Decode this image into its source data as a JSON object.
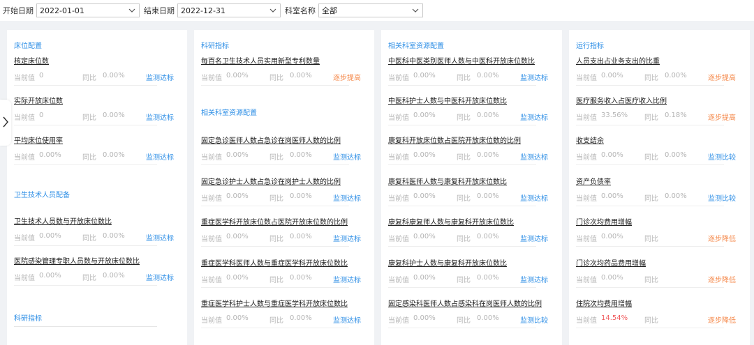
{
  "filters": {
    "start_label": "开始日期",
    "start_value": "2022-01-01",
    "end_label": "结束日期",
    "end_value": "2022-12-31",
    "dept_label": "科室名称",
    "dept_value": "全部"
  },
  "labels": {
    "current": "当前值",
    "yoy": "同比"
  },
  "status_colors": {
    "blue": "#2f8fe6",
    "orange": "#f5894b"
  },
  "columns": [
    {
      "sections": [
        {
          "title": "床位配置",
          "items": [
            {
              "title": "核定床位数",
              "current": "0",
              "yoy": "0.00%",
              "status": "监测达标",
              "color": "blue"
            },
            {
              "title": "实际开放床位数",
              "current": "0",
              "yoy": "0.00%",
              "status": "监测达标",
              "color": "blue"
            },
            {
              "title": "平均床位使用率",
              "current": "0.00%",
              "yoy": "0.00%",
              "status": "监测达标",
              "color": "blue"
            }
          ]
        },
        {
          "title": "卫生技术人员配备",
          "items": [
            {
              "title": "卫生技术人员数与开放床位数比",
              "current": "0.00%",
              "yoy": "0.00%",
              "status": "监测达标",
              "color": "blue"
            },
            {
              "title": "医院感染管理专职人员数与开放床位数比",
              "current": "0.00%",
              "yoy": "0.00%",
              "status": "监测达标",
              "color": "blue"
            }
          ]
        },
        {
          "title": "科研指标",
          "items": []
        }
      ]
    },
    {
      "sections": [
        {
          "title": "科研指标",
          "items": [
            {
              "title": "每百名卫生技术人员实用新型专利数量",
              "current": "0.00%",
              "yoy": "0.00%",
              "status": "逐步提高",
              "color": "orange"
            }
          ]
        },
        {
          "title": "相关科室资源配置",
          "items": [
            {
              "title": "固定急诊医师人数占急诊在岗医师人数的比例",
              "current": "0.00%",
              "yoy": "0.00%",
              "status": "监测达标",
              "color": "blue"
            },
            {
              "title": "固定急诊护士人数占急诊在岗护士人数的比例",
              "current": "0.00%",
              "yoy": "0.00%",
              "status": "监测达标",
              "color": "blue"
            },
            {
              "title": "重症医学科开放床位数占医院开放床位数的比例",
              "current": "0.00%",
              "yoy": "0.00%",
              "status": "监测达标",
              "color": "blue"
            },
            {
              "title": "重症医学科医师人数与重症医学科开放床位数比",
              "current": "0.00%",
              "yoy": "0.00%",
              "status": "监测达标",
              "color": "blue"
            },
            {
              "title": "重症医学科护士人数与重症医学科开放床位数比",
              "current": "0.00%",
              "yoy": "0.00%",
              "status": "监测达标",
              "color": "blue"
            }
          ]
        }
      ]
    },
    {
      "sections": [
        {
          "title": "相关科室资源配置",
          "items": [
            {
              "title": "中医科中医类别医师人数与中医科开放床位数比",
              "current": "0.00%",
              "yoy": "0.00%",
              "status": "监测达标",
              "color": "blue"
            },
            {
              "title": "中医科护士人数与中医科开放床位数比",
              "current": "0.00%",
              "yoy": "0.00%",
              "status": "监测达标",
              "color": "blue"
            },
            {
              "title": "康复科开放床位数占医院开放床位数的比例",
              "current": "0.00%",
              "yoy": "0.00%",
              "status": "监测达标",
              "color": "blue"
            },
            {
              "title": "康复科医师人数与康复科开放床位数比",
              "current": "0.00%",
              "yoy": "0.00%",
              "status": "监测达标",
              "color": "blue"
            },
            {
              "title": "康复科康复师人数与康复科开放床位数比",
              "current": "0.00%",
              "yoy": "0.00%",
              "status": "监测达标",
              "color": "blue"
            },
            {
              "title": "康复科护士人数与康复科开放床位数比",
              "current": "0.00%",
              "yoy": "0.00%",
              "status": "监测达标",
              "color": "blue"
            },
            {
              "title": "固定感染科医师人数占感染科在岗医师人数的比例",
              "current": "0.00%",
              "yoy": "0.00%",
              "status": "监测比较",
              "color": "blue"
            }
          ]
        }
      ]
    },
    {
      "sections": [
        {
          "title": "运行指标",
          "items": [
            {
              "title": "人员支出占业务支出的比重",
              "current": "0.00%",
              "yoy": "0.00%",
              "status": "逐步提高",
              "color": "orange"
            },
            {
              "title": "医疗服务收入占医疗收入比例",
              "current": "33.56%",
              "yoy": "0.18%",
              "status": "逐步提高",
              "color": "orange"
            },
            {
              "title": "收支结余",
              "current": "0.00%",
              "yoy": "0.00%",
              "status": "监测比较",
              "color": "blue"
            },
            {
              "title": "资产负债率",
              "current": "0.00%",
              "yoy": "0.00%",
              "status": "监测比较",
              "color": "blue"
            },
            {
              "title": "门诊次均费用增幅",
              "current": "0.00%",
              "yoy": "",
              "status": "逐步降低",
              "color": "orange"
            },
            {
              "title": "门诊次均药品费用增幅",
              "current": "0.00%",
              "yoy": "",
              "status": "逐步降低",
              "color": "orange"
            },
            {
              "title": "住院次均费用增幅",
              "current": "14.54%",
              "yoy": "",
              "status": "逐步降低",
              "color": "orange",
              "current_red": true
            }
          ]
        }
      ]
    }
  ]
}
